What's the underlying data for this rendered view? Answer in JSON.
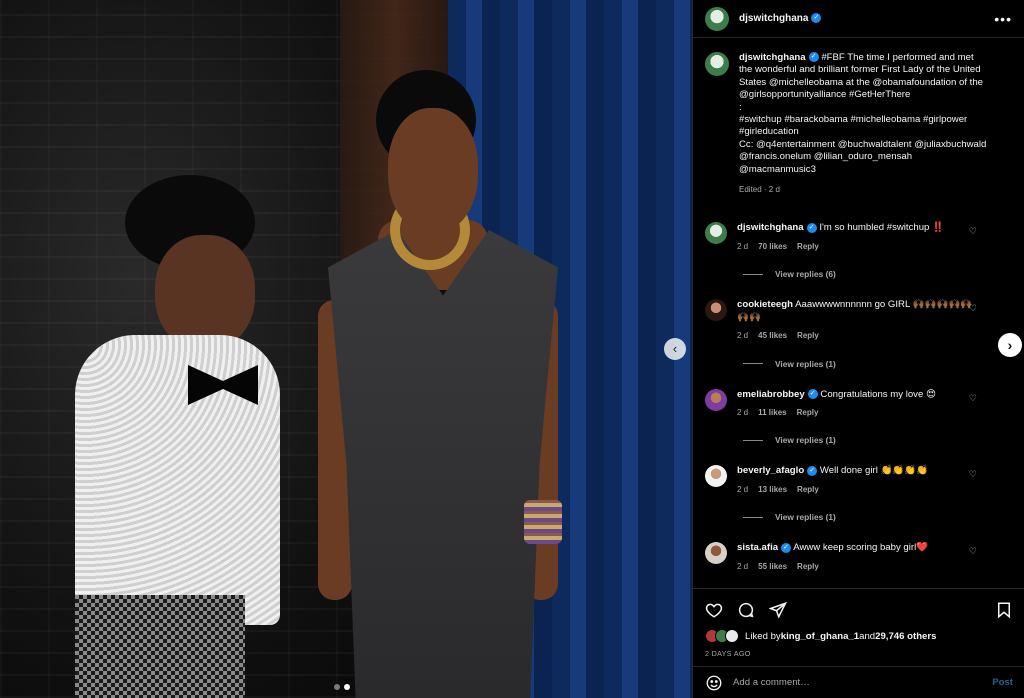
{
  "header": {
    "username": "djswitchghana",
    "more": "•••"
  },
  "caption": {
    "username": "djswitchghana",
    "lines": [
      "#FBF The time I performed and met the wonderful and brilliant former First Lady of the United States @michelleobama at the @obamafoundation of the @girlsopportunityalliance #GetHerThere",
      ":",
      "#switchup #barackobama #michelleobama #girlpower #girleducation",
      "Cc: @q4entertainment @buchwaldtalent @juliaxbuchwald @francis.onelum @lilian_oduro_mensah @macmanmusic3"
    ],
    "meta": "Edited · 2 d"
  },
  "comments": [
    {
      "username": "djswitchghana",
      "verified": true,
      "text": "I'm so humbled #switchup ‼️",
      "age": "2 d",
      "likes": "70 likes",
      "reply": "Reply",
      "replies": "View replies (6)"
    },
    {
      "username": "cookieteegh",
      "verified": false,
      "text": "Aaawwwwnnnnnn go GIRL 🙌🏾🙌🏾🙌🏾🙌🏾🙌🏾🙌🏾🙌🏾",
      "age": "2 d",
      "likes": "45 likes",
      "reply": "Reply",
      "replies": "View replies (1)"
    },
    {
      "username": "emeliabrobbey",
      "verified": true,
      "text": "Congratulations my love 😍",
      "age": "2 d",
      "likes": "11 likes",
      "reply": "Reply",
      "replies": "View replies (1)"
    },
    {
      "username": "beverly_afaglo",
      "verified": true,
      "text": "Well done girl 👏👏👏👏",
      "age": "2 d",
      "likes": "13 likes",
      "reply": "Reply",
      "replies": "View replies (1)"
    },
    {
      "username": "sista.afia",
      "verified": true,
      "text": "Awww keep scoring baby girl❤️",
      "age": "2 d",
      "likes": "55 likes",
      "reply": "Reply",
      "replies": ""
    }
  ],
  "likes": {
    "prefix": "Liked by ",
    "user": "king_of_ghana_1",
    "middle": " and ",
    "count": "29,746 others"
  },
  "date": "2 DAYS AGO",
  "add_comment": {
    "placeholder": "Add a comment…",
    "post_label": "Post"
  },
  "carousel": {
    "prev": "‹",
    "next": "›"
  }
}
